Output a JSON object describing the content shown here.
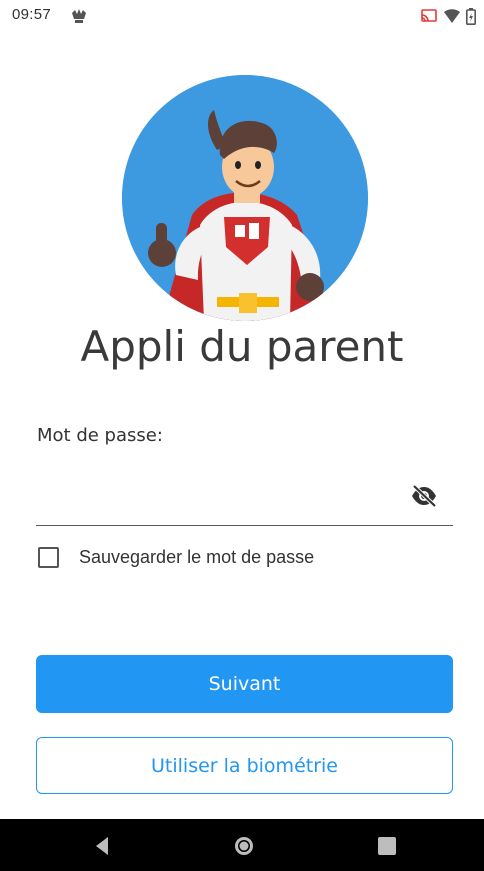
{
  "status_bar": {
    "time": "09:57",
    "left_icon": "notification-app-icon",
    "right_icons": [
      "cast-icon",
      "wifi-icon",
      "battery-icon"
    ]
  },
  "avatar": {
    "icon": "superhero-mascot-illustration",
    "background_color": "#3d9ae0"
  },
  "app": {
    "title": "Appli du parent"
  },
  "form": {
    "password_label": "Mot de passe:",
    "password_value": "",
    "toggle_icon": "eye-off-icon",
    "save_password_label": "Sauvegarder le mot de passe",
    "save_password_checked": false
  },
  "buttons": {
    "next_label": "Suivant",
    "biometric_label": "Utiliser la biométrie",
    "primary_color": "#2196f3"
  },
  "nav_bar": {
    "icons": [
      "back-icon",
      "home-icon",
      "recents-icon"
    ]
  }
}
